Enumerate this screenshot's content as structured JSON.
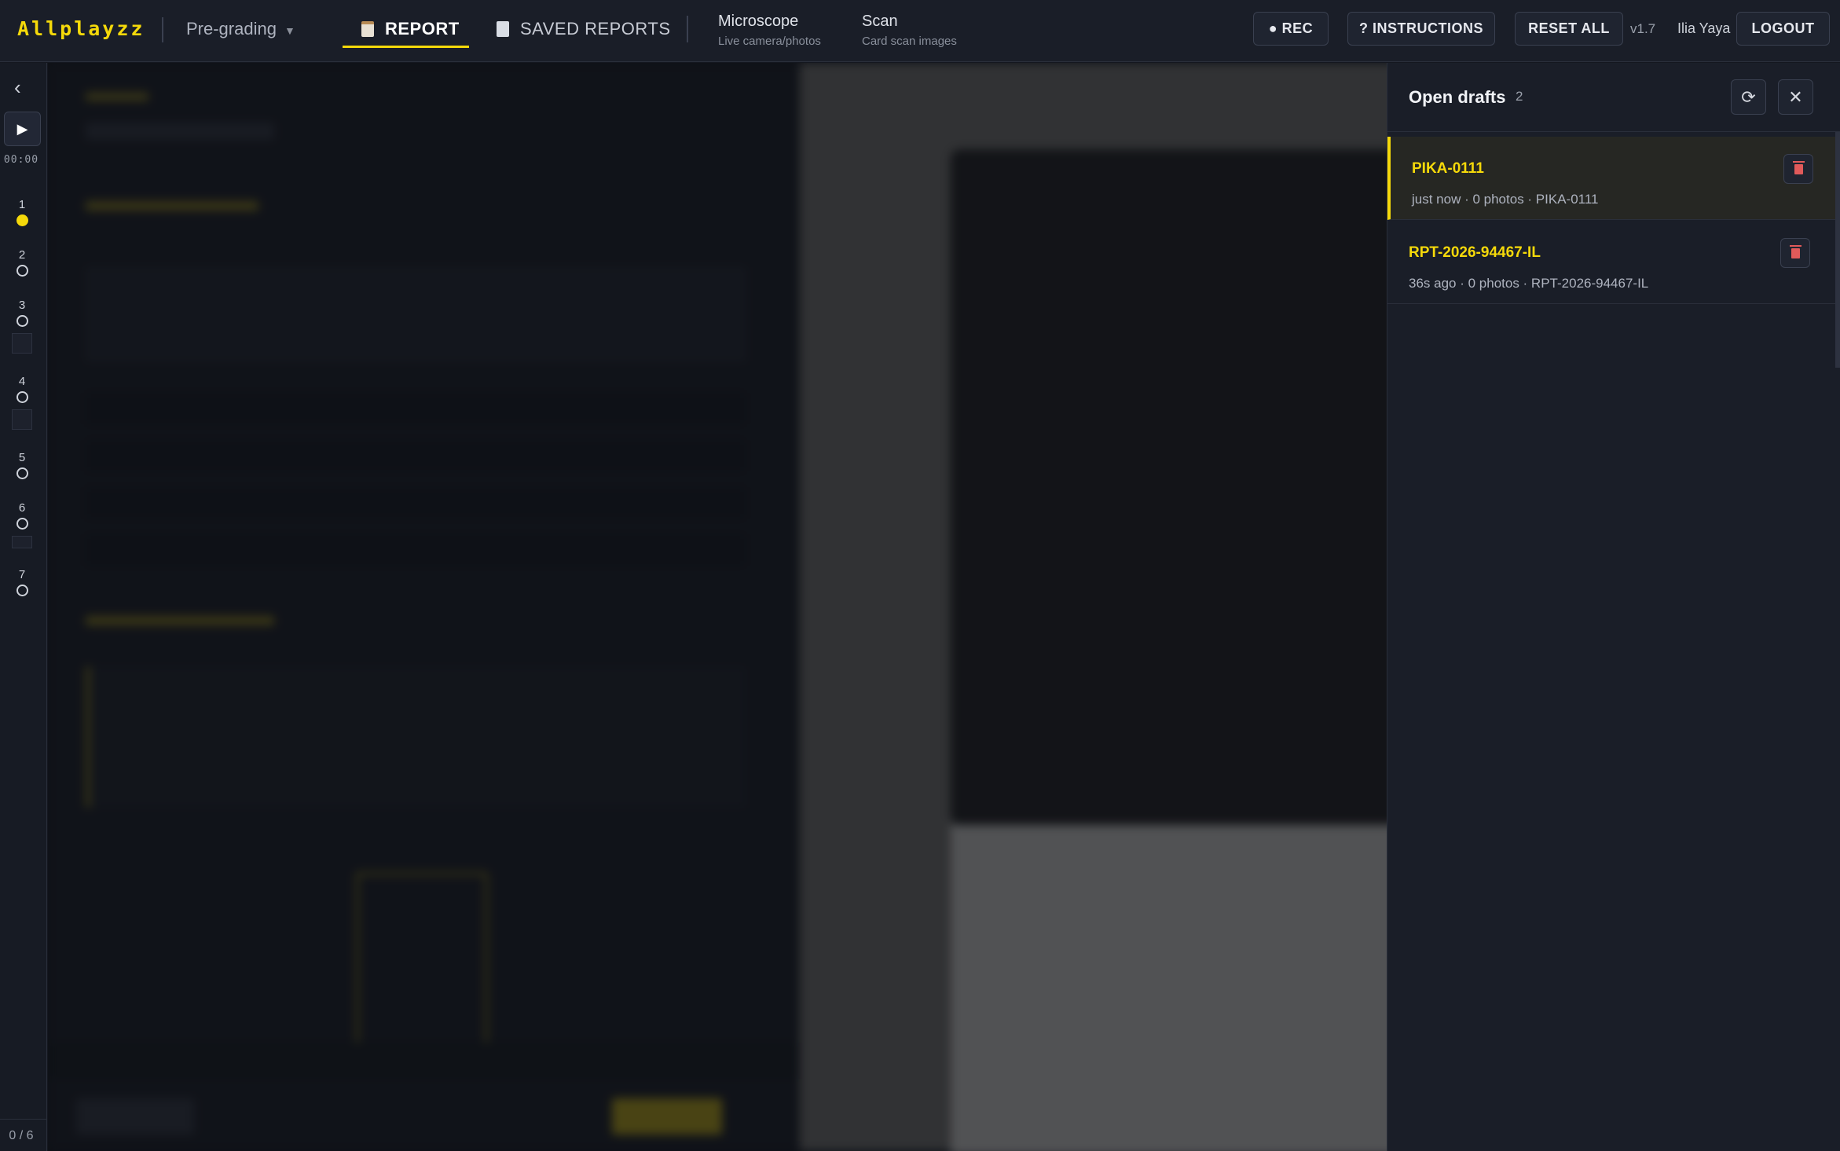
{
  "app": {
    "logo": "Allplayzz",
    "mode": "Pre-grading",
    "version": "v1.7",
    "user": "Ilia Yaya"
  },
  "nav": {
    "report": "REPORT",
    "saved": "SAVED REPORTS",
    "microscope": {
      "title": "Microscope",
      "subtitle": "Live camera/photos"
    },
    "scan": {
      "title": "Scan",
      "subtitle": "Card scan images"
    }
  },
  "actions": {
    "rec": "● REC",
    "instructions": "? INSTRUCTIONS",
    "reset": "RESET ALL",
    "logout": "LOGOUT"
  },
  "rail": {
    "timer": "00:00",
    "steps": [
      "1",
      "2",
      "3",
      "4",
      "5",
      "6",
      "7"
    ],
    "active_step": 1,
    "progress": "0 / 6"
  },
  "drafts": {
    "title": "Open drafts",
    "count": "2",
    "items": [
      {
        "name": "PIKA-0111",
        "meta": "just now  · 0 photos · PIKA-0111",
        "active": true
      },
      {
        "name": "RPT-2026-94467-IL",
        "meta": "36s ago  · 0 photos · RPT-2026-94467-IL",
        "active": false
      }
    ]
  },
  "colors": {
    "accent": "#f5d90a",
    "background": "#14171f",
    "panel": "#1a1e28",
    "danger": "#e05a5a"
  }
}
